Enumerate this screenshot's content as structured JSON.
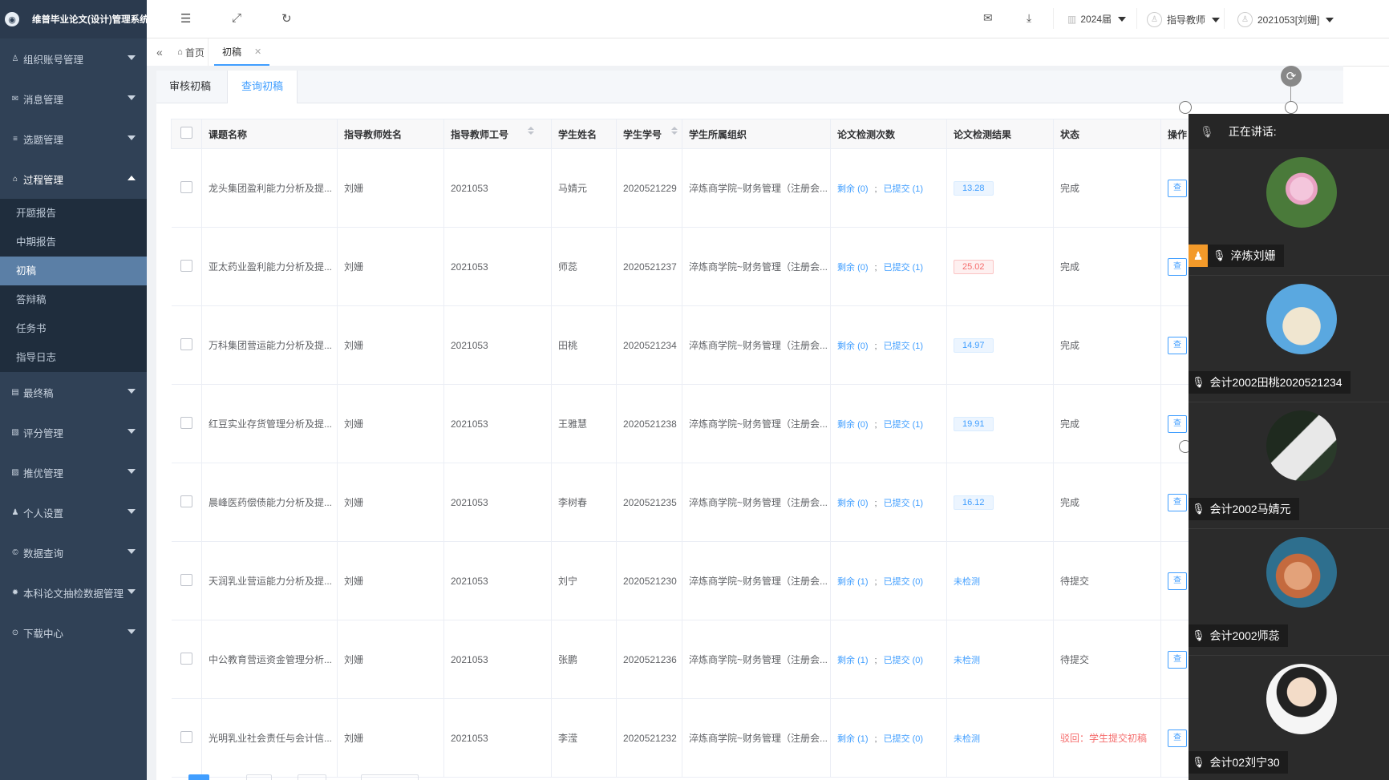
{
  "app": {
    "title": "维普毕业论文(设计)管理系统"
  },
  "sidebar": {
    "menus_top": [
      {
        "label": "组织账号管理",
        "icon": "user-icon"
      },
      {
        "label": "消息管理",
        "icon": "message-icon"
      },
      {
        "label": "选题管理",
        "icon": "list-icon"
      },
      {
        "label": "过程管理",
        "icon": "process-icon"
      }
    ],
    "submenu": [
      {
        "label": "开题报告"
      },
      {
        "label": "中期报告"
      },
      {
        "label": "初稿"
      },
      {
        "label": "答辩稿"
      },
      {
        "label": "任务书"
      },
      {
        "label": "指导日志"
      }
    ],
    "menus_bottom": [
      {
        "label": "最终稿",
        "icon": "document-icon"
      },
      {
        "label": "评分管理",
        "icon": "score-icon"
      },
      {
        "label": "推优管理",
        "icon": "recommend-icon"
      },
      {
        "label": "个人设置",
        "icon": "person-icon"
      },
      {
        "label": "数据查询",
        "icon": "query-icon"
      },
      {
        "label": "本科论文抽检数据管理",
        "icon": "gear-icon"
      },
      {
        "label": "下载中心",
        "icon": "download-icon"
      }
    ]
  },
  "topbar": {
    "year": "2024届",
    "role": "指导教师",
    "user": "2021053[刘姗]"
  },
  "tags": {
    "home": "首页",
    "current": "初稿"
  },
  "subtabs": [
    "审核初稿",
    "查询初稿"
  ],
  "table": {
    "headers": [
      "课题名称",
      "指导教师姓名",
      "指导教师工号",
      "学生姓名",
      "学生学号",
      "学生所属组织",
      "论文检测次数",
      "论文检测结果",
      "状态",
      "操作"
    ],
    "remaining_label": "剩余",
    "submitted_label": "已提交",
    "view_label": "查",
    "rows": [
      {
        "topic": "龙头集团盈利能力分析及提...",
        "teacher": "刘姗",
        "tid": "2021053",
        "student": "马婧元",
        "sid": "2020521229",
        "org": "淬炼商学院~财务管理（注册会...",
        "remain": "(0)",
        "submitted": "(1)",
        "result": "13.28",
        "status": "完成"
      },
      {
        "topic": "亚太药业盈利能力分析及提...",
        "teacher": "刘姗",
        "tid": "2021053",
        "student": "师蕊",
        "sid": "2020521237",
        "org": "淬炼商学院~财务管理（注册会...",
        "remain": "(0)",
        "submitted": "(1)",
        "result": "25.02",
        "status": "完成"
      },
      {
        "topic": "万科集团营运能力分析及提...",
        "teacher": "刘姗",
        "tid": "2021053",
        "student": "田桃",
        "sid": "2020521234",
        "org": "淬炼商学院~财务管理（注册会...",
        "remain": "(0)",
        "submitted": "(1)",
        "result": "14.97",
        "status": "完成"
      },
      {
        "topic": "红豆实业存货管理分析及提...",
        "teacher": "刘姗",
        "tid": "2021053",
        "student": "王雅慧",
        "sid": "2020521238",
        "org": "淬炼商学院~财务管理（注册会...",
        "remain": "(0)",
        "submitted": "(1)",
        "result": "19.91",
        "status": "完成"
      },
      {
        "topic": "晨峰医药偿债能力分析及提...",
        "teacher": "刘姗",
        "tid": "2021053",
        "student": "李树春",
        "sid": "2020521235",
        "org": "淬炼商学院~财务管理（注册会...",
        "remain": "(0)",
        "submitted": "(1)",
        "result": "16.12",
        "status": "完成"
      },
      {
        "topic": "天润乳业营运能力分析及提...",
        "teacher": "刘姗",
        "tid": "2021053",
        "student": "刘宁",
        "sid": "2020521230",
        "org": "淬炼商学院~财务管理（注册会...",
        "remain": "(1)",
        "submitted": "(0)",
        "result": "未检测",
        "status": "待提交"
      },
      {
        "topic": "中公教育营运资金管理分析...",
        "teacher": "刘姗",
        "tid": "2021053",
        "student": "张鹏",
        "sid": "2020521236",
        "org": "淬炼商学院~财务管理（注册会...",
        "remain": "(1)",
        "submitted": "(0)",
        "result": "未检测",
        "status": "待提交"
      },
      {
        "topic": "光明乳业社会责任与会计信...",
        "teacher": "刘姗",
        "tid": "2021053",
        "student": "李滢",
        "sid": "2020521232",
        "org": "淬炼商学院~财务管理（注册会...",
        "remain": "(1)",
        "submitted": "(0)",
        "result": "未检测",
        "status": "驳回：学生提交初稿"
      }
    ]
  },
  "panel": {
    "title": "正在讲话:",
    "participants": [
      {
        "name": "淬炼刘姗",
        "speaking": true
      },
      {
        "name": "会计2002田桃2020521234",
        "speaking": false
      },
      {
        "name": "会计2002马婧元",
        "speaking": false
      },
      {
        "name": "会计2002师蕊",
        "speaking": false
      },
      {
        "name": "会计02刘宁30",
        "speaking": false
      }
    ]
  },
  "colors": {
    "sidebar_bg": "#304156",
    "active_menu": "#5b7fa6",
    "primary": "#409eff",
    "danger": "#f56c6c",
    "speaking_badge": "#f39a2a"
  }
}
